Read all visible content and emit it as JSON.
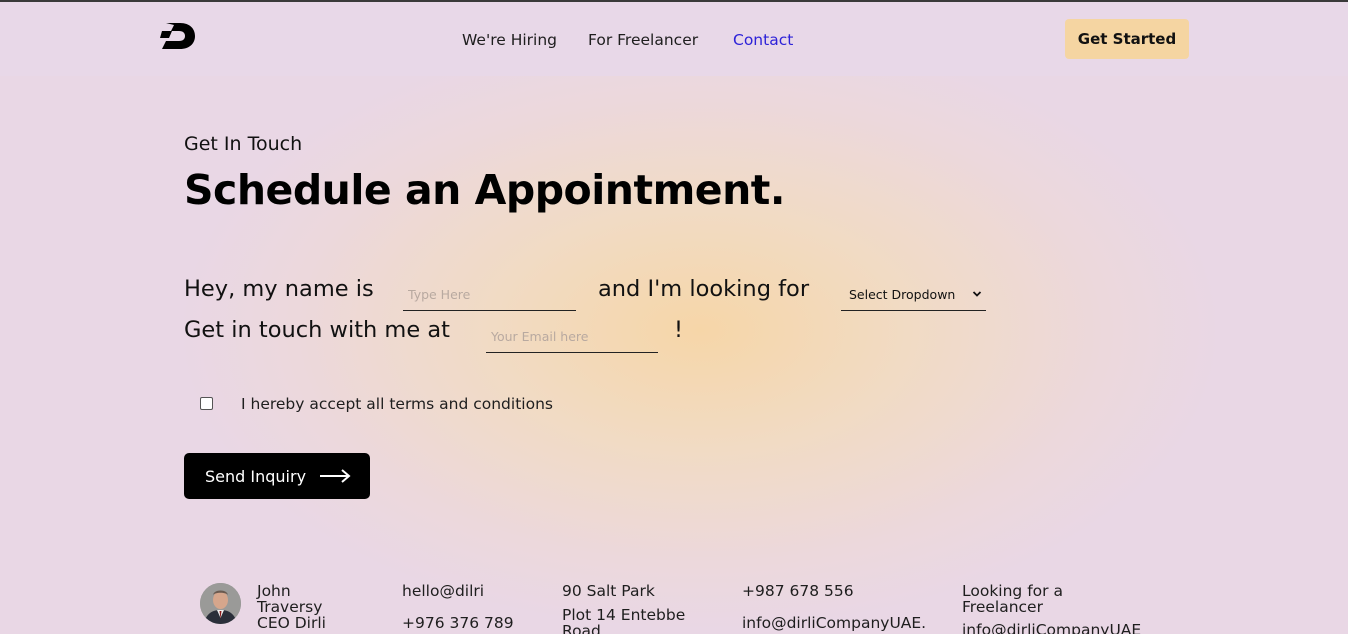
{
  "nav": {
    "links": [
      "We're Hiring",
      "For Freelancer",
      "Contact"
    ],
    "active_link": "Contact",
    "cta_label": "Get Started",
    "logo_icon": "brand-d-logo"
  },
  "hero": {
    "eyebrow": "Get In Touch",
    "title": "Schedule an Appointment."
  },
  "form": {
    "line1_prefix": "Hey, my name is",
    "name_placeholder": "Type Here",
    "line1_middle": "and I'm looking for",
    "dropdown_selected": "Select Dropdown",
    "line2_prefix": "Get in touch with me at",
    "email_placeholder": "Your Email here",
    "line2_suffix": "!",
    "terms_label": "I hereby accept all terms and conditions",
    "terms_checked": false,
    "submit_label": "Send Inquiry"
  },
  "footer": {
    "contact_name_line1": "John",
    "contact_name_line2": "Traversy",
    "contact_role": "CEO Dirli",
    "email_short": "hello@dilri",
    "phone_1": "+976 376 789",
    "address_line1": "90 Salt Park",
    "address_line2": "Plot 14 Entebbe",
    "address_line3": "Road",
    "phone_2": "+987 678 556",
    "email_uae": "info@dirliCompanyUAE.",
    "freelancer_line1": "Looking for a",
    "freelancer_line2": "Freelancer",
    "freelancer_email": "info@dirliCompanyUAE"
  },
  "colors": {
    "accent_cta": "#f5d5a2",
    "nav_bg": "#e8d8e8",
    "active_link": "#2d22d8",
    "button_dark": "#000000"
  }
}
